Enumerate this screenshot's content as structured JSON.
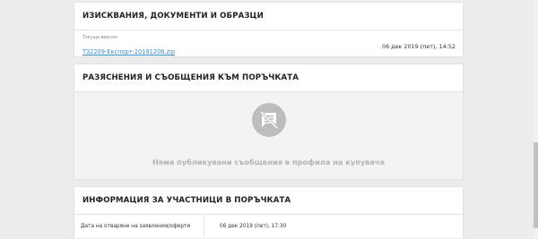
{
  "documents_card": {
    "title": "ИЗИСКВАНИЯ, ДОКУМЕНТИ И ОБРАЗЦИ",
    "current_version_label": "Текуща версия:",
    "file_name": "T32209-Експорт-20191206.zip",
    "file_date": "06 дек 2019 (пет), 14:52"
  },
  "messages_card": {
    "title": "РАЗЯСНЕНИЯ И СЪОБЩЕНИЯ КЪМ ПОРЪЧКАТА",
    "empty_icon": "no-messages-icon",
    "empty_text": "Няма публикувани съобщения в профила на купувача"
  },
  "participants_card": {
    "title": "ИНФОРМАЦИЯ ЗА УЧАСТНИЦИ В ПОРЪЧКАТА",
    "rows": [
      {
        "label": "Дата на отваряне на заявления/оферти",
        "value": "06 дек 2019 (пет), 17:30"
      }
    ]
  },
  "colors": {
    "background": "#ececec",
    "link": "#3a8ec2",
    "empty_text": "#b3b3b3",
    "icon_circle": "#bdbdbd"
  }
}
